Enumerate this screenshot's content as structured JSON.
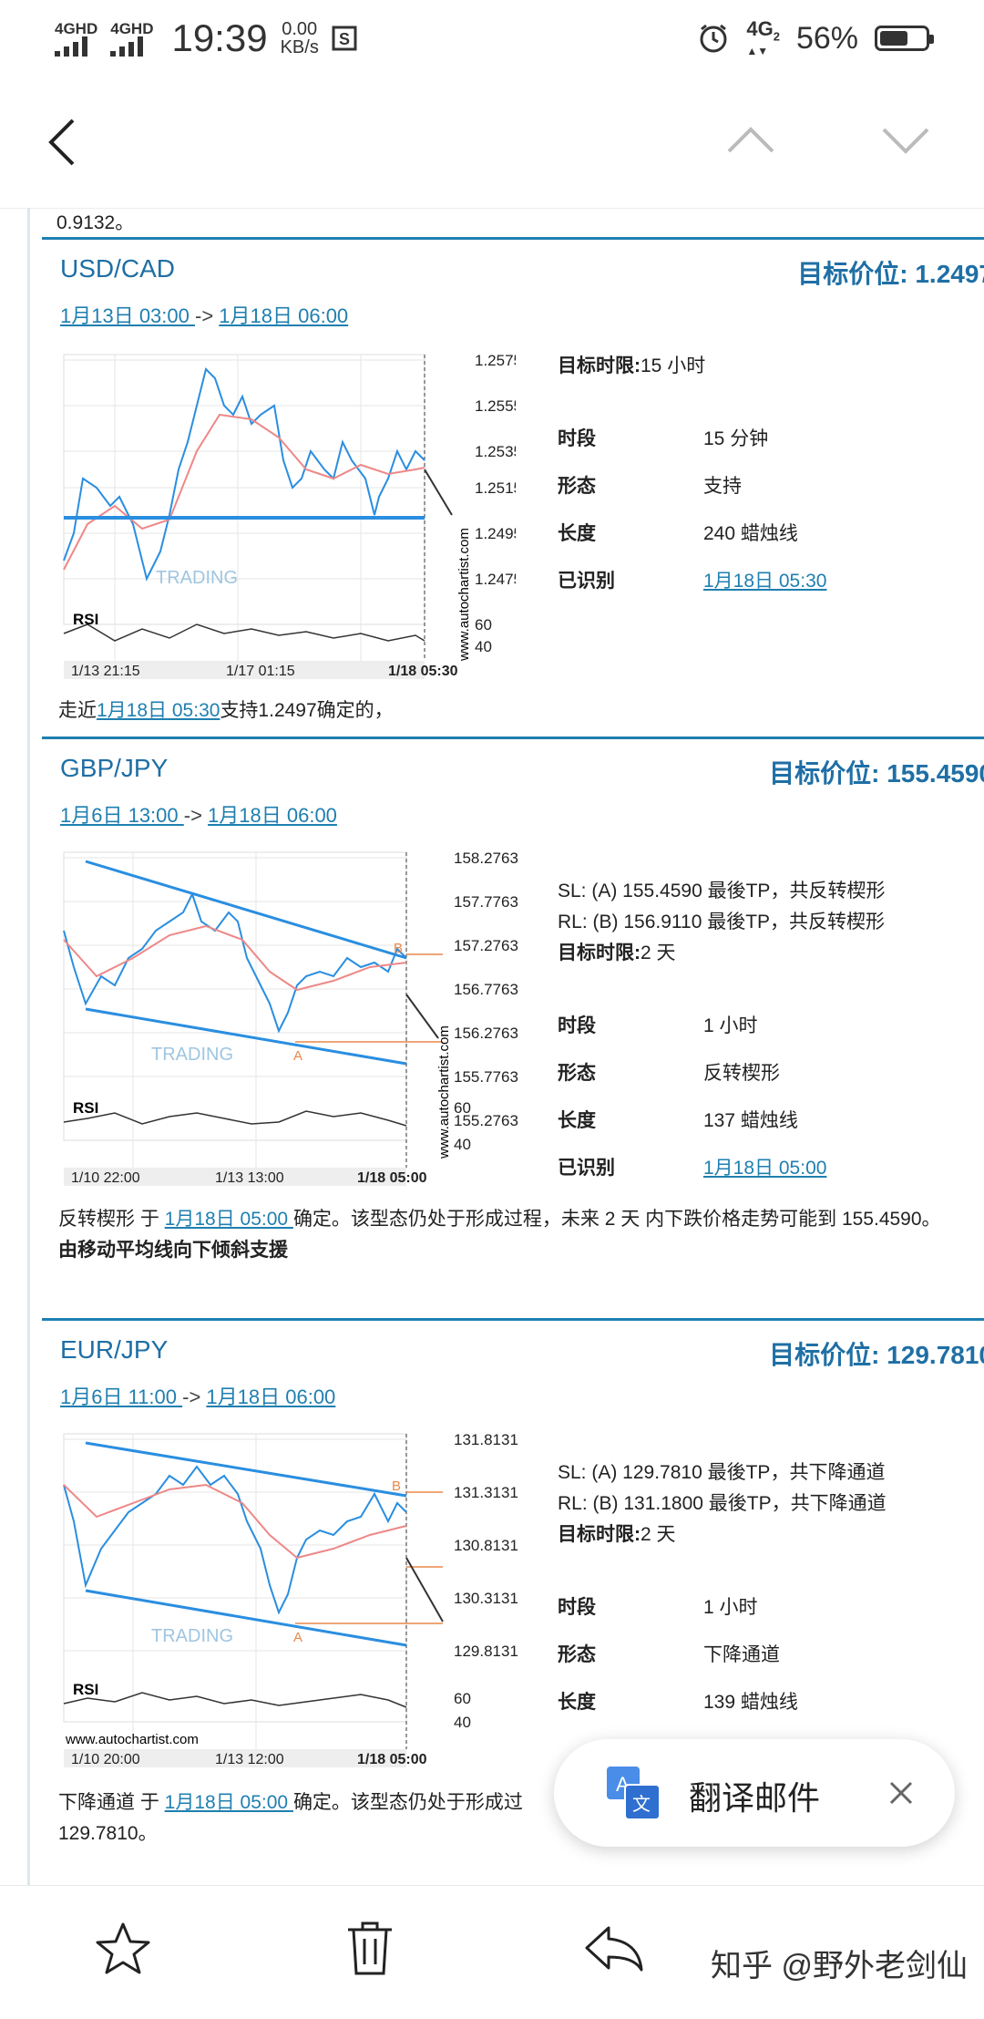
{
  "status_bar": {
    "signal1_label": "4GHD",
    "signal2_label": "4GHD",
    "time": "19:39",
    "net_speed_value": "0.00",
    "net_speed_unit": "KB/s",
    "network": "4G",
    "network_sub": "2",
    "battery": "56%"
  },
  "cards": [
    {
      "pair": "USD/CAD",
      "target": "目标价位: 1.2497",
      "from": "1月13日 03:00 ",
      "arrow": " -> ",
      "to": "1月18日 06:00",
      "chart": {
        "y_ticks": [
          "1.2575",
          "1.2555",
          "1.2535",
          "1.2515",
          "1.2495",
          "1.2475"
        ],
        "rsi_label": "RSI",
        "rsi_ticks": [
          "60",
          "40"
        ],
        "x_ticks": [
          "1/13 21:15",
          "1/17 01:15",
          "1/18 05:30"
        ],
        "watermark": "www.autochartist.com",
        "brand": "TRADING"
      },
      "info": [
        {
          "k": "目标时限: ",
          "v": "15 小时"
        },
        {
          "k": "时段",
          "v": "15 分钟"
        },
        {
          "k": "形态",
          "v": "支持"
        },
        {
          "k": "长度",
          "v": "240 蜡烛线"
        },
        {
          "k": "已识别",
          "v": "1月18日 05:30"
        }
      ],
      "desc_prefix": "走近",
      "desc_link": "1月18日 05:30",
      "desc_suffix": "支持1.2497确定的，"
    },
    {
      "pair": "GBP/JPY",
      "target": "目标价位: 155.4590",
      "from": "1月6日 13:00 ",
      "arrow": " -> ",
      "to": "1月18日 06:00",
      "chart": {
        "y_ticks": [
          "158.2763",
          "157.7763",
          "157.2763",
          "156.7763",
          "156.2763",
          "155.7763",
          "155.2763"
        ],
        "rsi_label": "RSI",
        "rsi_ticks": [
          "60",
          "40"
        ],
        "x_ticks": [
          "1/10 22:00",
          "1/13 13:00",
          "1/18 05:00"
        ],
        "watermark": "www.autochartist.com",
        "brand": "TRADING",
        "label_a": "A",
        "label_b": "B"
      },
      "sl": "SL: (A) 155.4590  最後TP，共反转楔形",
      "rl": "RL: (B) 156.9110  最後TP，共反转楔形",
      "info": [
        {
          "k": "目标时限: ",
          "v": "2 天"
        },
        {
          "k": "时段",
          "v": "1 小时"
        },
        {
          "k": "形态",
          "v": "反转楔形"
        },
        {
          "k": "长度",
          "v": "137 蜡烛线"
        },
        {
          "k": "已识别",
          "v": "1月18日 05:00"
        }
      ],
      "desc_prefix": "反转楔形 于 ",
      "desc_link": "1月18日 05:00 ",
      "desc_suffix": "确定。该型态仍处于形成过程，未来 2 天 内下跌价格走势可能到 155.4590。",
      "desc_bold": "由移动平均线向下倾斜支援"
    },
    {
      "pair": "EUR/JPY",
      "target": "目标价位: 129.7810",
      "from": "1月6日 11:00 ",
      "arrow": " -> ",
      "to": "1月18日 06:00",
      "chart": {
        "y_ticks": [
          "131.8131",
          "131.3131",
          "130.8131",
          "130.3131",
          "129.8131"
        ],
        "rsi_label": "RSI",
        "rsi_ticks": [
          "60",
          "40"
        ],
        "x_ticks": [
          "1/10 20:00",
          "1/13 12:00",
          "1/18 05:00"
        ],
        "watermark": "www.autochartist.com",
        "brand": "TRADING",
        "label_a": "A",
        "label_b": "B"
      },
      "sl": "SL: (A) 129.7810  最後TP，共下降通道",
      "rl": "RL: (B) 131.1800  最後TP，共下降通道",
      "info": [
        {
          "k": "目标时限: ",
          "v": "2 天"
        },
        {
          "k": "时段",
          "v": "1 小时"
        },
        {
          "k": "形态",
          "v": "下降通道"
        },
        {
          "k": "长度",
          "v": "139 蜡烛线"
        }
      ],
      "desc_prefix": "下降通道 于 ",
      "desc_link": "1月18日 05:00 ",
      "desc_suffix": "确定。该型态仍处于形成过",
      "desc_line2": "129.7810。"
    }
  ],
  "top_fragment": "0.9132。",
  "toast": {
    "label": "翻译邮件"
  },
  "watermark": "知乎 @野外老剑仙"
}
